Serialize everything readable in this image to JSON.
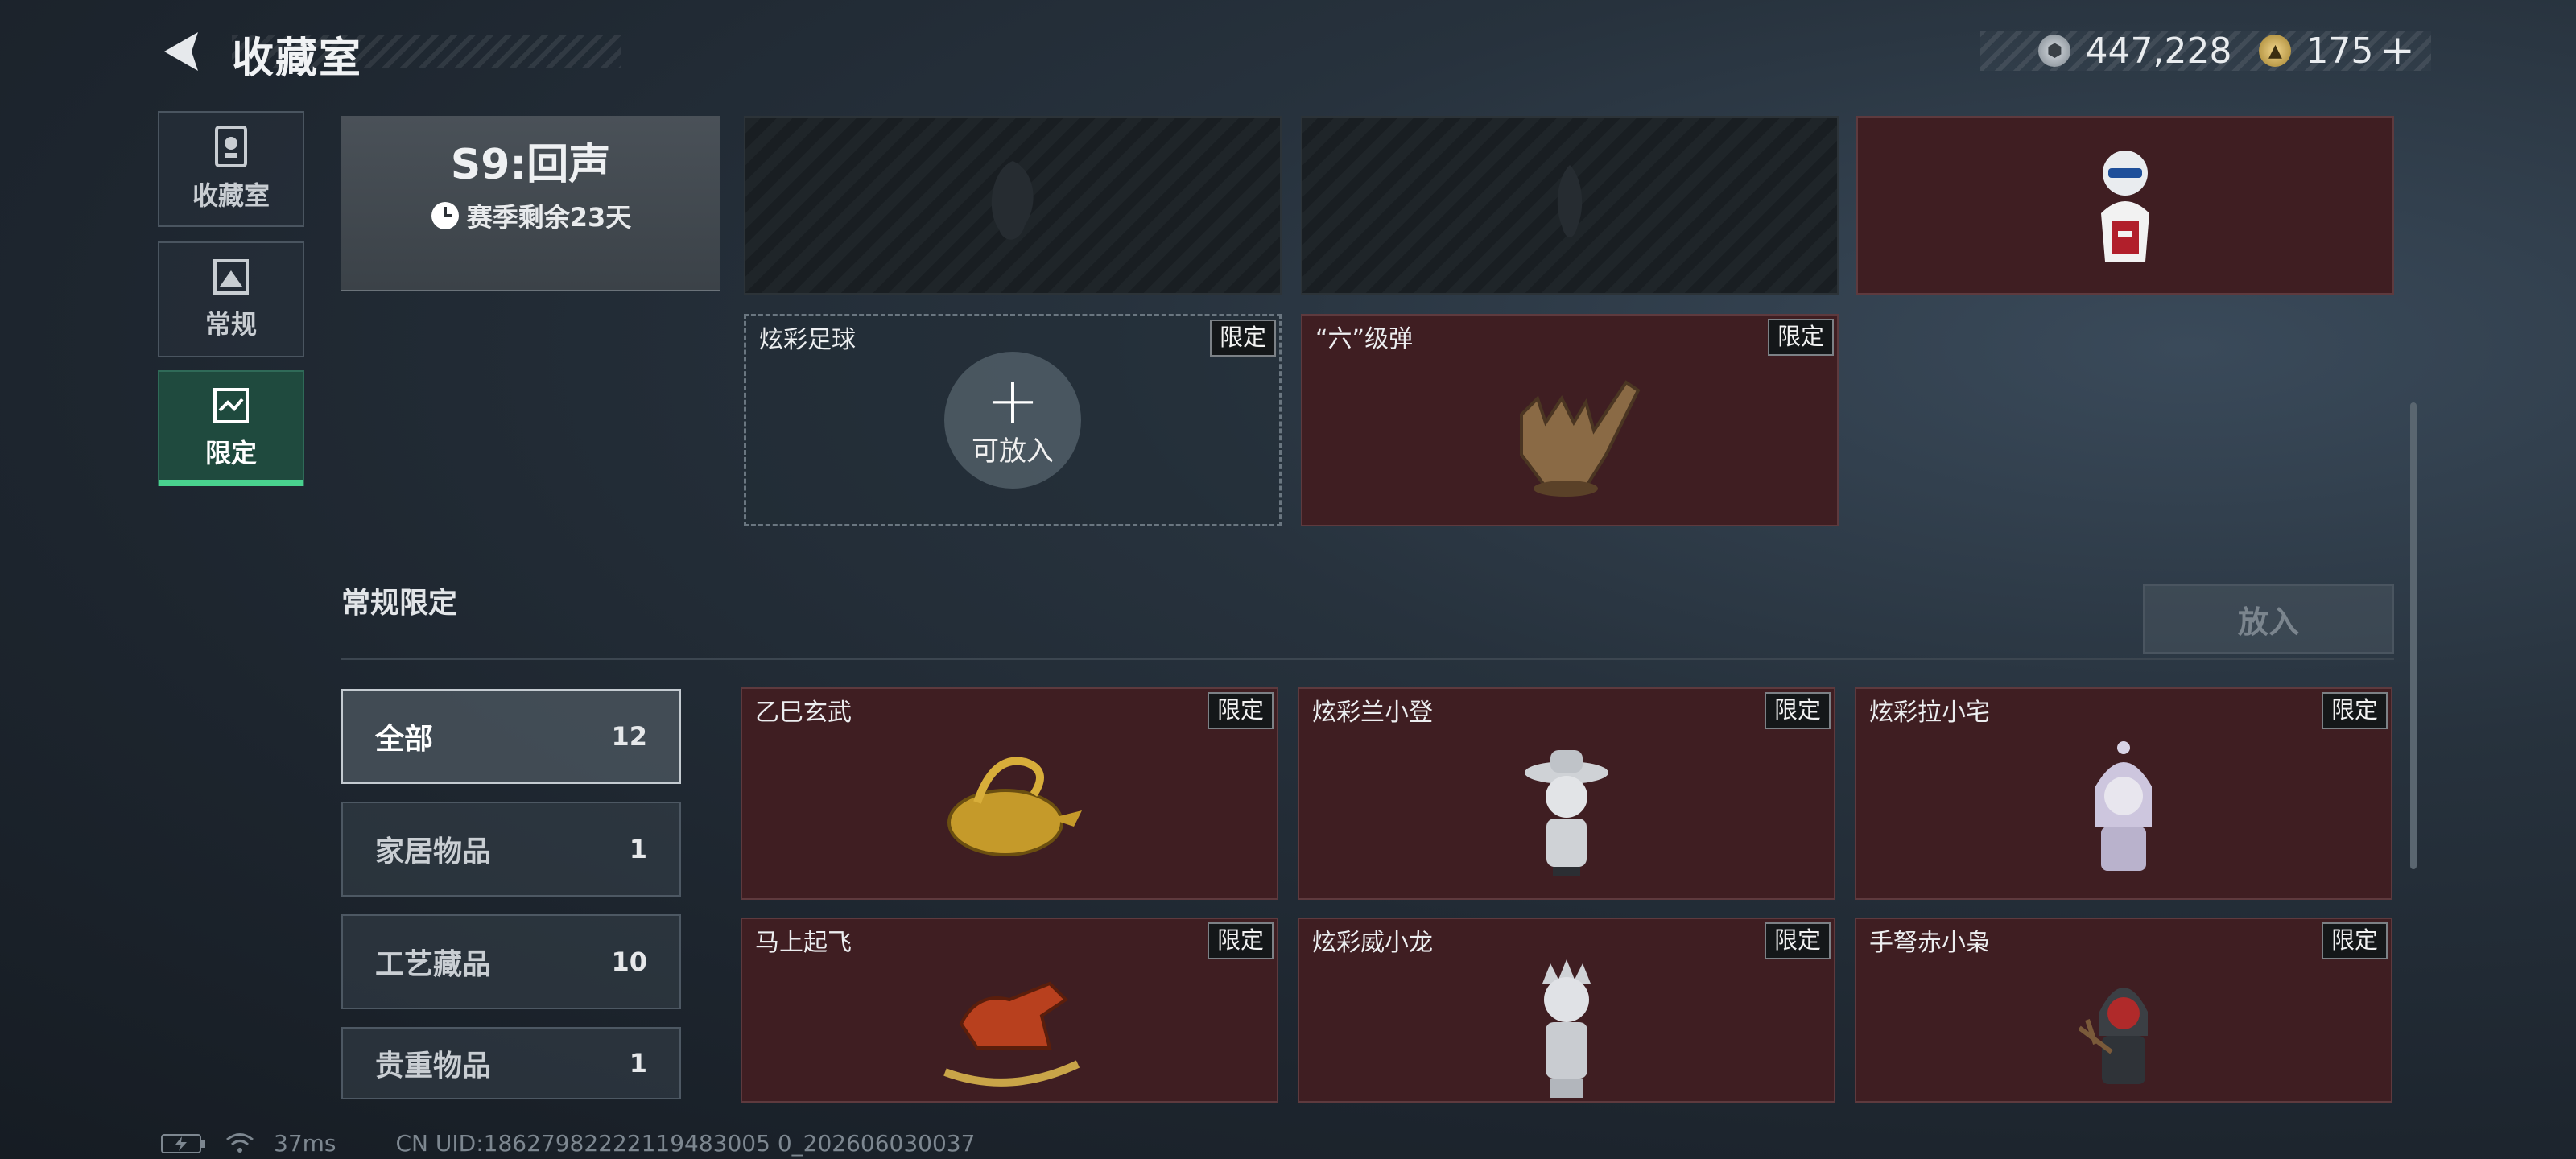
{
  "header": {
    "title": "收藏室"
  },
  "currency": [
    {
      "icon": "silver-coin-icon",
      "value": "447,228"
    },
    {
      "icon": "gold-triangle-coin-icon",
      "value": "175"
    }
  ],
  "nav": [
    {
      "label": "收藏室",
      "icon": "trophy-icon"
    },
    {
      "label": "常规",
      "icon": "picture-icon"
    },
    {
      "label": "限定",
      "icon": "limited-icon",
      "active": true
    }
  ],
  "season": {
    "title": "S9:回声",
    "remaining": "赛季剩余23天"
  },
  "top_cards": [
    {
      "name": "炫彩足球",
      "tag": "限定",
      "placeholder": "可放入"
    },
    {
      "name": "“六”级弹",
      "tag": "限定"
    }
  ],
  "section": {
    "title": "常规限定",
    "put_button": "放入"
  },
  "categories": [
    {
      "label": "全部",
      "count": "12"
    },
    {
      "label": "家居物品",
      "count": "1"
    },
    {
      "label": "工艺藏品",
      "count": "10"
    },
    {
      "label": "贵重物品",
      "count": "1"
    }
  ],
  "grid": [
    {
      "name": "乙巳玄武",
      "tag": "限定"
    },
    {
      "name": "炫彩兰小登",
      "tag": "限定"
    },
    {
      "name": "炫彩拉小宅",
      "tag": "限定"
    },
    {
      "name": "马上起飞",
      "tag": "限定"
    },
    {
      "name": "炫彩威小龙",
      "tag": "限定"
    },
    {
      "name": "手弩赤小枭",
      "tag": "限定"
    }
  ],
  "footer": {
    "ping": "37ms",
    "uid": "CN UID:18627982222119483005 0_202606030037"
  },
  "colors": {
    "accent": "#49d18e",
    "card_red": "#3f1e22"
  }
}
